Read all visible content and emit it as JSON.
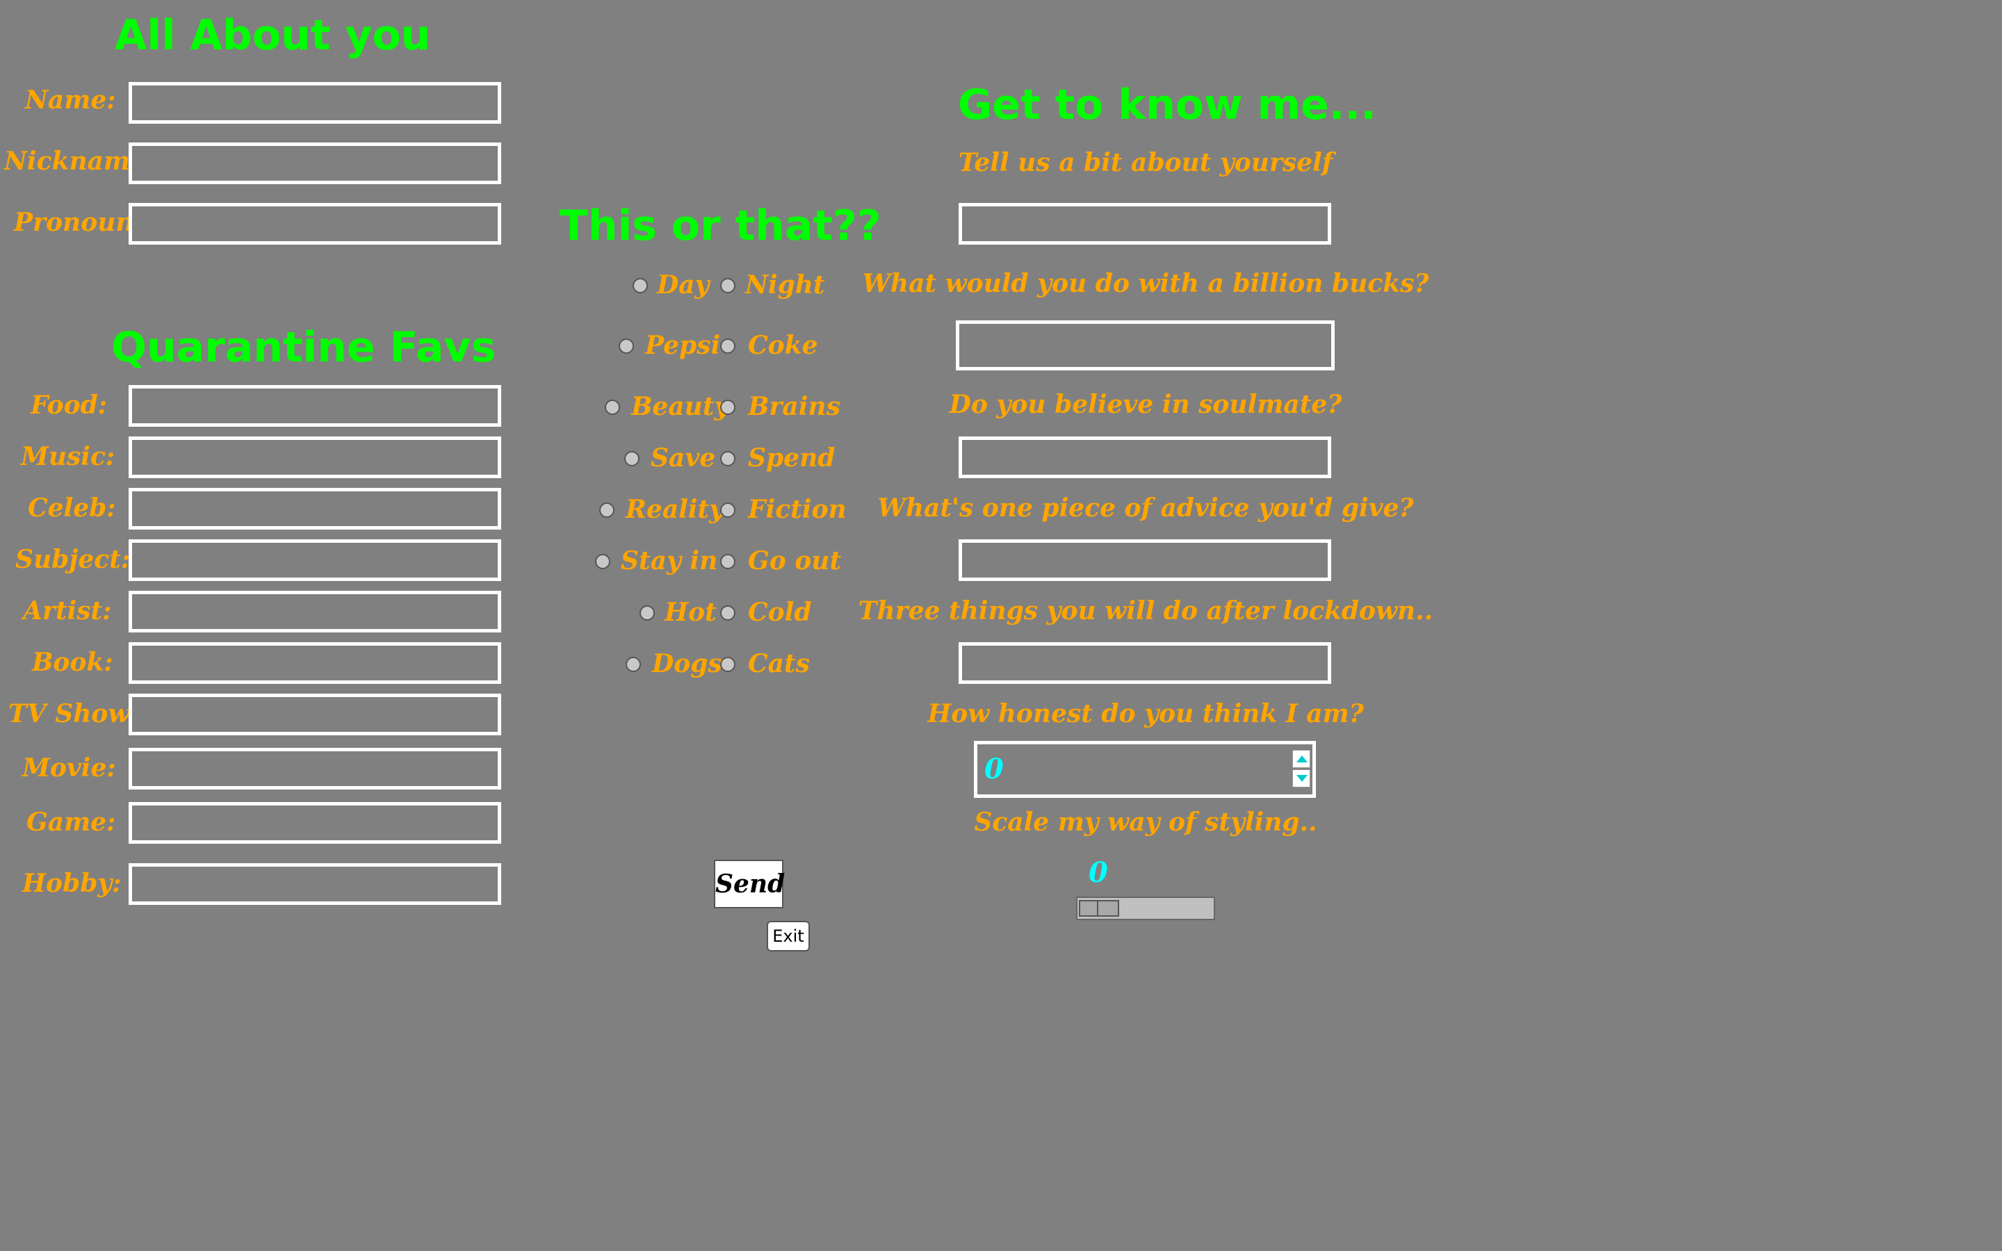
{
  "left": {
    "title": "All About you",
    "fields": [
      {
        "label": "Name:",
        "value": ""
      },
      {
        "label": "Nickname:",
        "value": ""
      },
      {
        "label": "Pronoun:",
        "value": ""
      }
    ],
    "favs_title": "Quarantine Favs",
    "favs": [
      {
        "label": "Food:",
        "value": ""
      },
      {
        "label": "Music:",
        "value": ""
      },
      {
        "label": "Celeb:",
        "value": ""
      },
      {
        "label": "Subject:",
        "value": ""
      },
      {
        "label": "Artist:",
        "value": ""
      },
      {
        "label": "Book:",
        "value": ""
      },
      {
        "label": "TV Show:",
        "value": ""
      },
      {
        "label": "Movie:",
        "value": ""
      },
      {
        "label": "Game:",
        "value": ""
      },
      {
        "label": "Hobby:",
        "value": ""
      }
    ]
  },
  "this_or_that": {
    "title": "This or that??",
    "pairs": [
      {
        "a": "Day",
        "b": "Night",
        "selected": null
      },
      {
        "a": "Pepsi",
        "b": "Coke",
        "selected": null
      },
      {
        "a": "Beauty",
        "b": "Brains",
        "selected": null
      },
      {
        "a": "Save",
        "b": "Spend",
        "selected": null
      },
      {
        "a": "Reality",
        "b": "Fiction",
        "selected": null
      },
      {
        "a": "Stay in",
        "b": "Go out",
        "selected": null
      },
      {
        "a": "Hot",
        "b": "Cold",
        "selected": null
      },
      {
        "a": "Dogs",
        "b": "Cats",
        "selected": null
      }
    ],
    "send_label": "Send",
    "exit_label": "Exit"
  },
  "know_me": {
    "title": "Get to know me...",
    "questions": [
      {
        "label": "Tell us a bit about yourself",
        "value": ""
      },
      {
        "label": "What would you do with a billion bucks?",
        "value": ""
      },
      {
        "label": "Do you believe in soulmate?",
        "value": ""
      },
      {
        "label": "What's one piece of advice you'd give?",
        "value": ""
      },
      {
        "label": "Three things you will do after lockdown..",
        "value": ""
      }
    ],
    "honesty_label": "How honest do you think I am?",
    "honesty_value": "0",
    "style_label": "Scale my way of styling..",
    "style_value": "0",
    "style_scale_fraction": 0
  },
  "colors": {
    "background": "#808080",
    "heading": "#00ff00",
    "label": "#ffa500",
    "value_accent": "#00ffff",
    "field_border": "#ffffff"
  }
}
